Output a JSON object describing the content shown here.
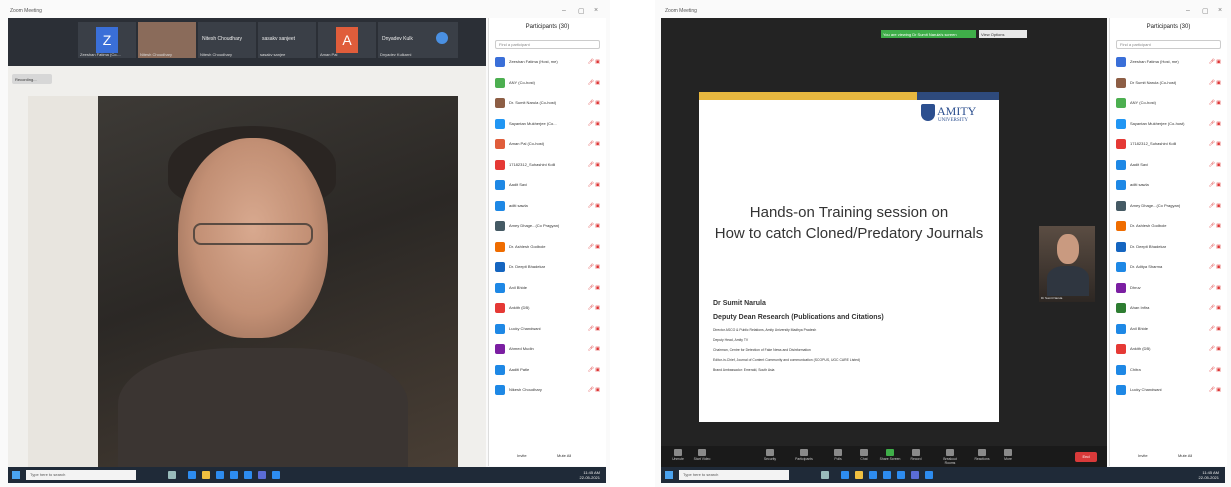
{
  "left": {
    "window_title": "Zoom Meeting",
    "recording_label": "Recording...",
    "thumbnails": [
      {
        "letter": "Z",
        "color": "#3a6fd8",
        "name": "Zeeshan Fatima (Co-..."
      },
      {
        "letter": "",
        "color": "#8a6b5a",
        "name": "Nitesh Choudhary"
      },
      {
        "letter": "",
        "color": "#3a3f47",
        "name_big": "Nitesh Choudhary",
        "name": "Nitesh Choudhary"
      },
      {
        "letter": "",
        "color": "#3a3f47",
        "name_big": "sasakv sanjeet",
        "name": "sasakv sanjee"
      },
      {
        "letter": "A",
        "color": "#e05d3b",
        "name": "Aman Pal"
      },
      {
        "letter": "",
        "color": "#3a3f47",
        "name_big": "Dnyadev Kulk",
        "name": "Dnyadev Kulkarni"
      }
    ],
    "taskbar_search": "Type here to search"
  },
  "participants_left": {
    "title": "Participants (30)",
    "search_placeholder": "Find a participant",
    "rows": [
      {
        "name": "Zeeshan Fatima (Host, me)",
        "color": "#3a6fd8"
      },
      {
        "name": "ANY (Co-host)",
        "color": "#4caf50"
      },
      {
        "name": "Dr. Sumit Narula (Co-host)",
        "color": "#8d5e45"
      },
      {
        "name": "Sayantan Mukherjee (Co...",
        "color": "#2196f3"
      },
      {
        "name": "Aman Pal (Co-host)",
        "color": "#e05d3b"
      },
      {
        "name": "17182312_Suhashini Kolli",
        "color": "#e53935"
      },
      {
        "name": "Aadit Savi",
        "color": "#1e88e5"
      },
      {
        "name": "aditi sawla",
        "color": "#1e88e5"
      },
      {
        "name": "Amey Dhage...(Co Pragyan)",
        "color": "#455a64"
      },
      {
        "name": "Dr. Ashlesh Godbole",
        "color": "#ef6c00"
      },
      {
        "name": "Dr. Deepti Bhadekar",
        "color": "#1565c0"
      },
      {
        "name": "Anil Bhide",
        "color": "#1e88e5"
      },
      {
        "name": "Ankith (DB)",
        "color": "#e53935"
      },
      {
        "name": "Lucky Chandwani",
        "color": "#1e88e5"
      },
      {
        "name": "Ahmed Mudin",
        "color": "#7b1fa2"
      },
      {
        "name": "Aaditi Patle",
        "color": "#1e88e5"
      },
      {
        "name": "Nikesh Choudhary",
        "color": "#1e88e5"
      }
    ],
    "footer_left": "Invite",
    "footer_right": "Mute All"
  },
  "right": {
    "window_title": "Zoom Meeting",
    "banner": "You are viewing Dr Sumit Narula's screen",
    "banner2": "View Options",
    "slide": {
      "logo": "AMITY",
      "logo_sub": "UNIVERSITY",
      "title_line1": "Hands-on Training session on",
      "title_line2": "How to catch Cloned/Predatory Journals",
      "name": "Dr Sumit Narula",
      "role": "Deputy Dean Research (Publications and Citations)",
      "lines": [
        "Director ASCO & Public Relations, Amity University Madhya Pradesh",
        "Deputy Head, Amity TV",
        "Chairman, Centre for Detection of Fake News and Disinformation",
        "Editor-in-Chief, Journal of Content Community and communication (SCOPUS, UGC CARE Listed)",
        "Brand Ambassador: Emerald, South Asia"
      ]
    },
    "speaker_name": "Dr Sumit Narula",
    "toolbar": [
      {
        "label": "Unmute"
      },
      {
        "label": "Start Video"
      },
      {
        "label": "Security"
      },
      {
        "label": "Participants"
      },
      {
        "label": "Polls"
      },
      {
        "label": "Chat"
      },
      {
        "label": "Share Screen"
      },
      {
        "label": "Record"
      },
      {
        "label": "Breakout Rooms"
      },
      {
        "label": "Reactions"
      },
      {
        "label": "More"
      }
    ],
    "end_label": "End",
    "taskbar_search": "Type here to search"
  },
  "participants_right": {
    "title": "Participants (30)",
    "search_placeholder": "Find a participant",
    "rows": [
      {
        "name": "Zeeshan Fatima (Host, me)",
        "color": "#3a6fd8"
      },
      {
        "name": "Dr Sumit Narula (Co-host)",
        "color": "#8d5e45"
      },
      {
        "name": "ANY (Co-host)",
        "color": "#4caf50"
      },
      {
        "name": "Sayantan Mukherjee (Co-host)",
        "color": "#2196f3"
      },
      {
        "name": "17182312_Suhashini Kolli",
        "color": "#e53935"
      },
      {
        "name": "Aadit Savi",
        "color": "#1e88e5"
      },
      {
        "name": "aditi sawla",
        "color": "#1e88e5"
      },
      {
        "name": "Amey Dhage...(Co Pragyan)",
        "color": "#455a64"
      },
      {
        "name": "Dr. Ashlesh Godbole",
        "color": "#ef6c00"
      },
      {
        "name": "Dr. Deepti Bhadekar",
        "color": "#1565c0"
      },
      {
        "name": "Dr. Aditya Sharma",
        "color": "#1e88e5"
      },
      {
        "name": "Dhruv",
        "color": "#7b1fa2"
      },
      {
        "name": "Ahan Infira",
        "color": "#2e7d32"
      },
      {
        "name": "Anil Bhide",
        "color": "#1e88e5"
      },
      {
        "name": "Ankith (DB)",
        "color": "#e53935"
      },
      {
        "name": "Chitra",
        "color": "#1e88e5"
      },
      {
        "name": "Lucky Chandwani",
        "color": "#1e88e5"
      }
    ],
    "footer_left": "Invite",
    "footer_right": "Mute All"
  },
  "clock": {
    "time": "11:45 AM",
    "date": "22-05-2021"
  }
}
